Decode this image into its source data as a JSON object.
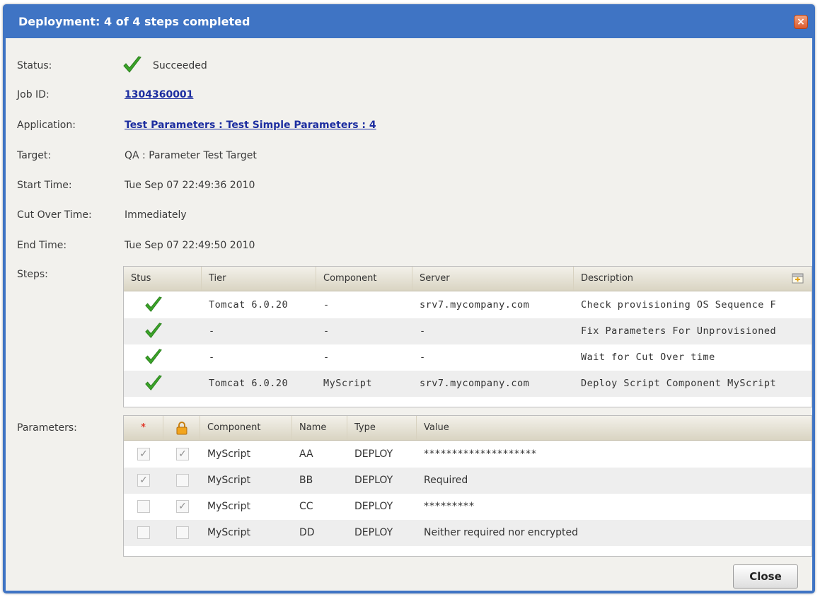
{
  "window": {
    "title": "Deployment: 4 of 4 steps completed",
    "close_glyph": "×"
  },
  "details": {
    "status_label": "Status:",
    "status_value": "Succeeded",
    "job_label": "Job ID:",
    "job_value": "1304360001",
    "application_label": "Application:",
    "application_value": "Test Parameters : Test Simple Parameters : 4",
    "target_label": "Target:",
    "target_value": "QA : Parameter Test Target",
    "start_label": "Start Time:",
    "start_value": "Tue Sep 07 22:49:36 2010",
    "cutover_label": "Cut Over Time:",
    "cutover_value": "Immediately",
    "end_label": "End Time:",
    "end_value": "Tue Sep 07 22:49:50 2010",
    "steps_label": "Steps:",
    "parameters_label": "Parameters:"
  },
  "steps": {
    "headers": {
      "status": "Stus",
      "tier": "Tier",
      "component": "Component",
      "server": "Server",
      "description": "Description"
    },
    "rows": [
      {
        "status": "success",
        "tier": "Tomcat 6.0.20",
        "component": "-",
        "server": "srv7.mycompany.com",
        "description": "Check provisioning OS Sequence F"
      },
      {
        "status": "success",
        "tier": "-",
        "component": "-",
        "server": "-",
        "description": "Fix Parameters For Unprovisioned"
      },
      {
        "status": "success",
        "tier": "-",
        "component": "-",
        "server": "-",
        "description": "Wait for Cut Over time"
      },
      {
        "status": "success",
        "tier": "Tomcat 6.0.20",
        "component": "MyScript",
        "server": "srv7.mycompany.com",
        "description": "Deploy Script Component MyScript"
      }
    ]
  },
  "parameters": {
    "headers": {
      "required": "*",
      "component": "Component",
      "name": "Name",
      "type": "Type",
      "value": "Value"
    },
    "rows": [
      {
        "required": true,
        "encrypted": true,
        "component": "MyScript",
        "name": "AA",
        "type": "DEPLOY",
        "value": "********************"
      },
      {
        "required": true,
        "encrypted": false,
        "component": "MyScript",
        "name": "BB",
        "type": "DEPLOY",
        "value": "Required"
      },
      {
        "required": false,
        "encrypted": true,
        "component": "MyScript",
        "name": "CC",
        "type": "DEPLOY",
        "value": "*********"
      },
      {
        "required": false,
        "encrypted": false,
        "component": "MyScript",
        "name": "DD",
        "type": "DEPLOY",
        "value": "Neither required nor encrypted"
      }
    ]
  },
  "buttons": {
    "close": "Close"
  },
  "colors": {
    "title_bar": "#3f74c4",
    "success_check": "#3aa428",
    "link": "#1d2ea0",
    "required_star": "#e0392b"
  }
}
